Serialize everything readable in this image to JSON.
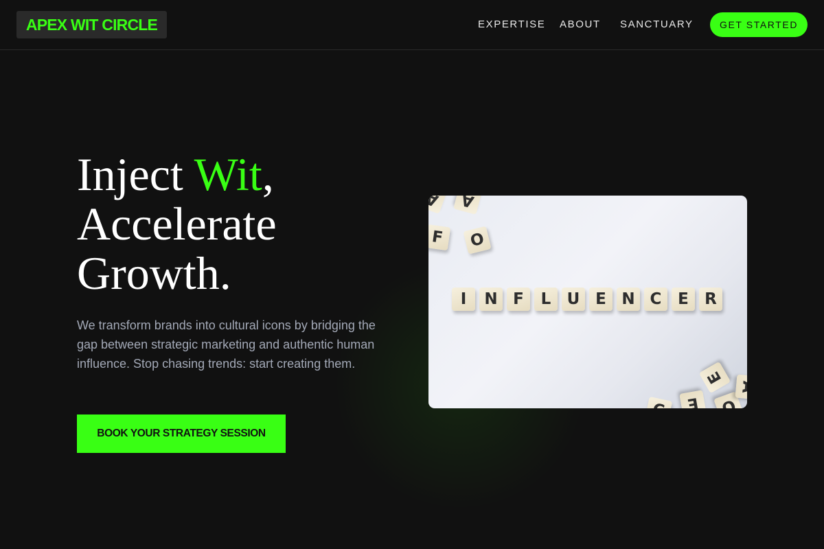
{
  "header": {
    "logo": "APEX WIT CIRCLE",
    "nav": [
      "EXPERTISE",
      "ABOUT",
      "SANCTUARY"
    ],
    "cta": "GET STARTED"
  },
  "hero": {
    "headline_part1": "Inject ",
    "headline_accent": "Wit",
    "headline_part2": ",",
    "headline_line2": "Accelerate",
    "headline_line3": "Growth.",
    "lead": "We transform brands into cultural icons by bridging the gap between strategic marketing and authentic human influence. Stop chasing trends: start creating them.",
    "cta": "BOOK YOUR STRATEGY SESSION"
  },
  "photo": {
    "word": [
      "I",
      "N",
      "F",
      "L",
      "U",
      "E",
      "N",
      "C",
      "E",
      "R"
    ],
    "scattered": [
      "A",
      "A",
      "F",
      "O",
      "E",
      "E",
      "O",
      "C",
      "A"
    ]
  },
  "colors": {
    "accent": "#39ff14",
    "background": "#111111",
    "lead_text": "#a3a9b7"
  }
}
